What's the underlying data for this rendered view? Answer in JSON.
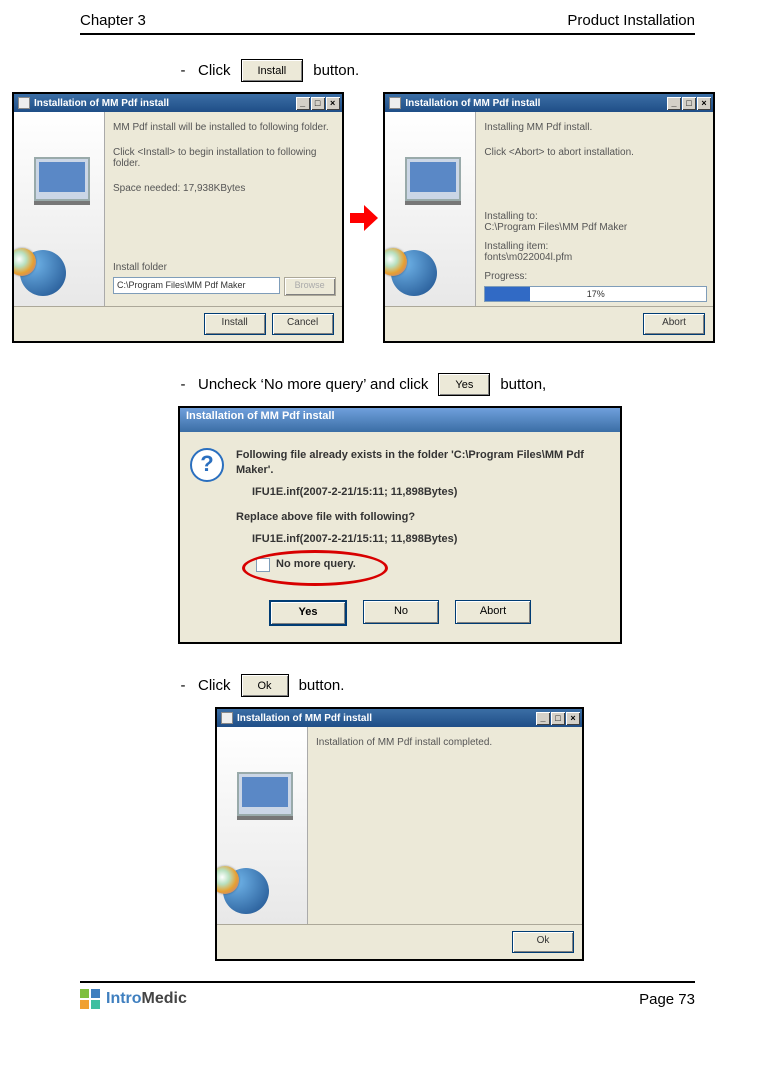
{
  "header": {
    "left": "Chapter 3",
    "right": "Product Installation"
  },
  "step1": {
    "text_before": "Click",
    "btn_label": "Install",
    "text_after": "button."
  },
  "win1": {
    "title": "Installation of MM Pdf install",
    "line1": "MM Pdf install will be installed to following folder.",
    "line2": "Click <Install> to begin installation to following folder.",
    "line3": "Space needed: 17,938KBytes",
    "folder_label": "Install folder",
    "folder_path": "C:\\Program Files\\MM Pdf Maker",
    "browse": "Browse",
    "btn_install": "Install",
    "btn_cancel": "Cancel"
  },
  "win2": {
    "title": "Installation of MM Pdf install",
    "line1": "Installing MM Pdf install.",
    "line2": "Click <Abort> to abort installation.",
    "installing_to_label": "Installing to:",
    "installing_to": "C:\\Program Files\\MM Pdf Maker",
    "item_label": "Installing item:",
    "item": "fonts\\m022004l.pfm",
    "progress_label": "Progress:",
    "progress_pct": "17%",
    "btn_abort": "Abort"
  },
  "step2": {
    "text_before": "Uncheck ‘No more query’ and click",
    "btn_label": "Yes",
    "text_after": "button,"
  },
  "dlg3": {
    "title": "Installation of MM Pdf install",
    "q": "?",
    "line_bold1": "Following file already exists in the folder 'C:\\Program Files\\MM Pdf Maker'.",
    "file1": "IFU1E.inf(2007-2-21/15:11; 11,898Bytes)",
    "line_bold2": "Replace above file with following?",
    "file2": "IFU1E.inf(2007-2-21/15:11; 11,898Bytes)",
    "nomore": "No more query.",
    "btn_yes": "Yes",
    "btn_no": "No",
    "btn_abort": "Abort"
  },
  "step3": {
    "text_before": "Click",
    "btn_label": "Ok",
    "text_after": "button."
  },
  "win4": {
    "title": "Installation of MM Pdf install",
    "line1": "Installation of MM Pdf install completed.",
    "btn_ok": "Ok"
  },
  "footer": {
    "logo1": "Intro",
    "logo2": "Medic",
    "page": "Page 73"
  }
}
